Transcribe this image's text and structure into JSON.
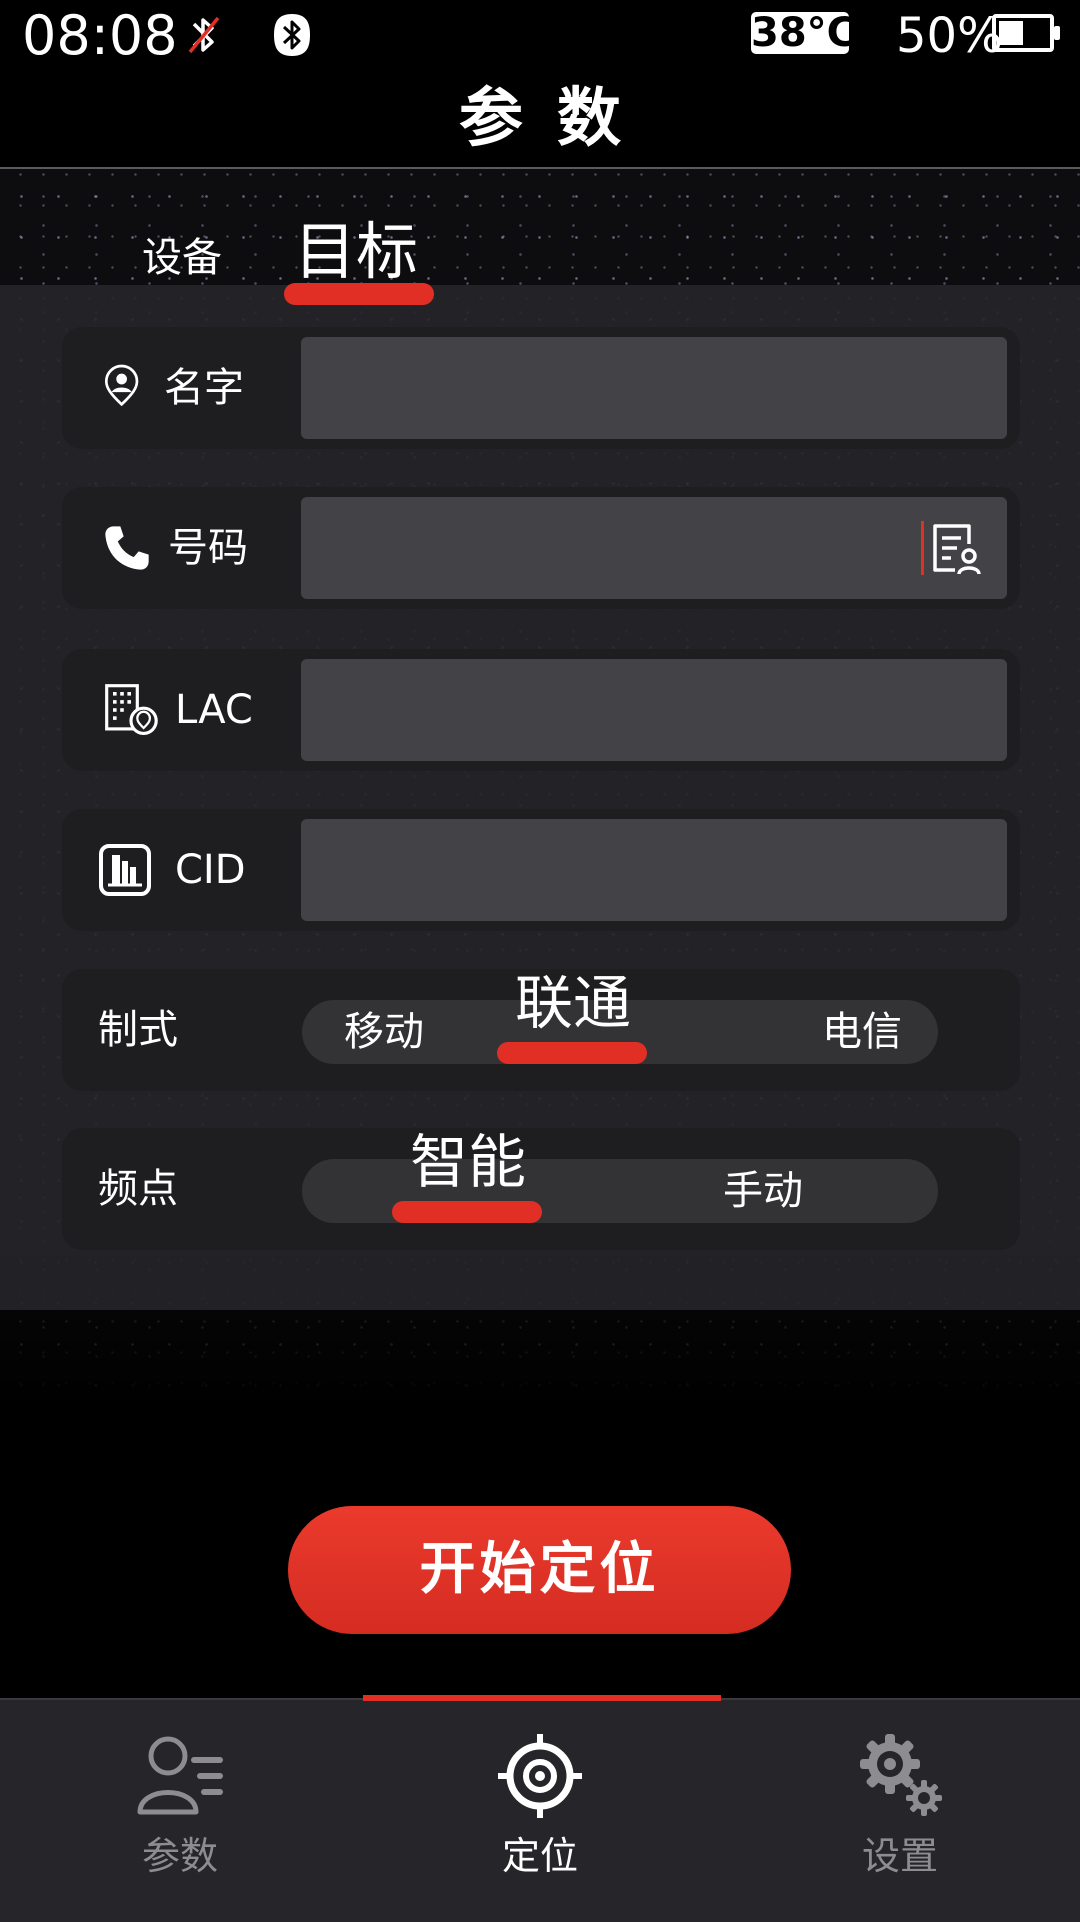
{
  "status_bar": {
    "time": "08:08",
    "temperature": "38°C",
    "battery_percent": "50%",
    "battery_level": 0.5,
    "bluetooth_off_icon": "bluetooth-off-icon",
    "bluetooth_icon": "bluetooth-icon"
  },
  "page_title": "参数",
  "tabs": {
    "device": "设备",
    "target": "目标",
    "active": "target"
  },
  "form": {
    "name": {
      "label": "名字",
      "value": "",
      "icon": "person-pin-icon"
    },
    "phone": {
      "label": "号码",
      "value": "",
      "icon": "phone-icon",
      "action_icon": "contact-book-icon"
    },
    "lac": {
      "label": "LAC",
      "value": "",
      "icon": "building-location-icon"
    },
    "cid": {
      "label": "CID",
      "value": "",
      "icon": "cell-tower-icon"
    }
  },
  "network": {
    "label": "制式",
    "options": [
      "移动",
      "联通",
      "电信"
    ],
    "selected": "联通"
  },
  "band": {
    "label": "频点",
    "options": [
      "智能",
      "手动"
    ],
    "selected": "智能"
  },
  "start_button": "开始定位",
  "bottom_nav": {
    "items": [
      {
        "label": "参数",
        "icon": "user-list-icon"
      },
      {
        "label": "定位",
        "icon": "crosshair-icon"
      },
      {
        "label": "设置",
        "icon": "gear-icon"
      }
    ],
    "active": "定位"
  },
  "colors": {
    "accent": "#e12f25",
    "panel": "#1e1e21",
    "input": "#434347",
    "nav_bg": "#26262a"
  }
}
